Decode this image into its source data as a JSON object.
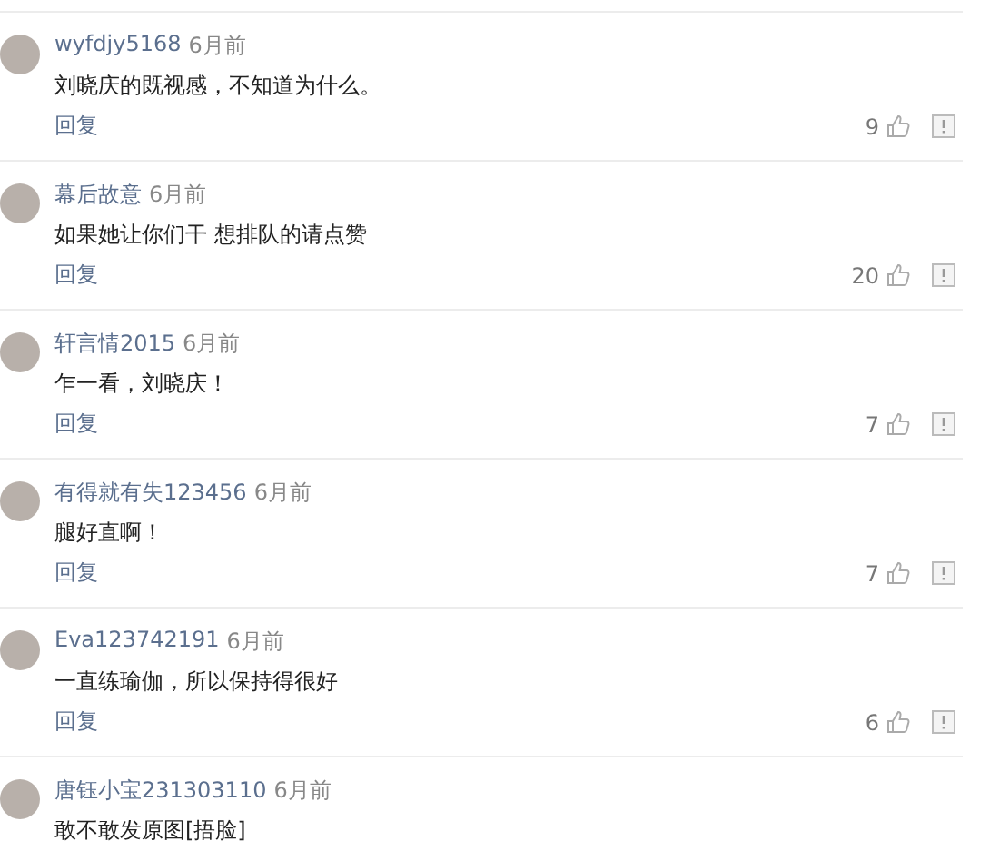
{
  "comments": [
    {
      "user": "wyfdjy5168",
      "time": "6月前",
      "text": "刘晓庆的既视感，不知道为什么。",
      "reply": "回复",
      "likes": "9"
    },
    {
      "user": "幕后故意",
      "time": "6月前",
      "text": "如果她让你们干 想排队的请点赞",
      "reply": "回复",
      "likes": "20"
    },
    {
      "user": "轩言情2015",
      "time": "6月前",
      "text": "乍一看，刘晓庆！",
      "reply": "回复",
      "likes": "7"
    },
    {
      "user": "有得就有失123456",
      "time": "6月前",
      "text": "腿好直啊！",
      "reply": "回复",
      "likes": "7"
    },
    {
      "user": "Eva123742191",
      "time": "6月前",
      "text": "一直练瑜伽，所以保持得很好",
      "reply": "回复",
      "likes": "6"
    },
    {
      "user": "唐钰小宝231303110",
      "time": "6月前",
      "text": "敢不敢发原图[捂脸]"
    }
  ]
}
